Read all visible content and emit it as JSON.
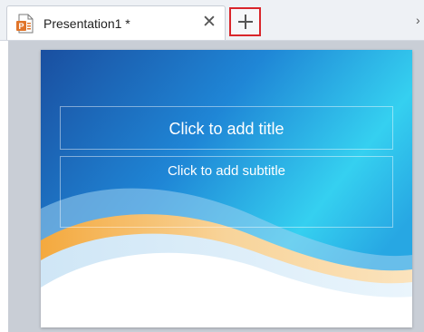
{
  "tab": {
    "title": "Presentation1 *",
    "icon": "presentation-file-icon",
    "close_glyph": "✕"
  },
  "new_tab": {
    "icon": "plus-icon",
    "highlight_color": "#d9262b"
  },
  "overflow": {
    "icon": "chevron-right-icon",
    "glyph": "›"
  },
  "slide": {
    "title_placeholder": "Click to add title",
    "subtitle_placeholder": "Click to add subtitle",
    "colors": {
      "sky_dark": "#1a4fa0",
      "sky_light": "#35d0f0",
      "wave_orange": "#f4b45a",
      "base": "#ffffff"
    }
  }
}
